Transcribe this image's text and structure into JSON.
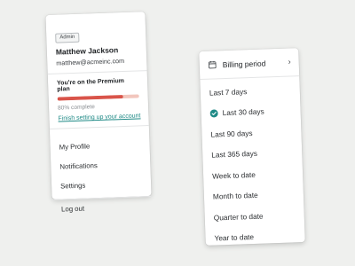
{
  "account_menu": {
    "role_badge": "Admin",
    "user_name": "Matthew Jackson",
    "user_email": "matthew@acmeinc.com",
    "plan_text": "You're on the Premium plan",
    "progress_percent": 80,
    "progress_label": "80% complete",
    "setup_link": "Finish setting up your account",
    "items": [
      {
        "label": "My Profile"
      },
      {
        "label": "Notifications"
      },
      {
        "label": "Settings"
      }
    ],
    "logout_label": "Log out",
    "colors": {
      "progress": "#d9544a",
      "progress_track": "#f2c6bd",
      "link": "#1f8a86"
    }
  },
  "billing_menu": {
    "title": "Billing period",
    "header_icon": "calendar-icon",
    "header_chevron": "chevron-right-icon",
    "selected": "Last 30 days",
    "options": [
      {
        "label": "Last 7 days"
      },
      {
        "label": "Last 30 days"
      },
      {
        "label": "Last 90 days"
      },
      {
        "label": "Last 365 days"
      },
      {
        "label": "Week to date"
      },
      {
        "label": "Month to date"
      },
      {
        "label": "Quarter to date"
      },
      {
        "label": "Year to date"
      }
    ],
    "colors": {
      "check": "#1f8a86"
    }
  }
}
